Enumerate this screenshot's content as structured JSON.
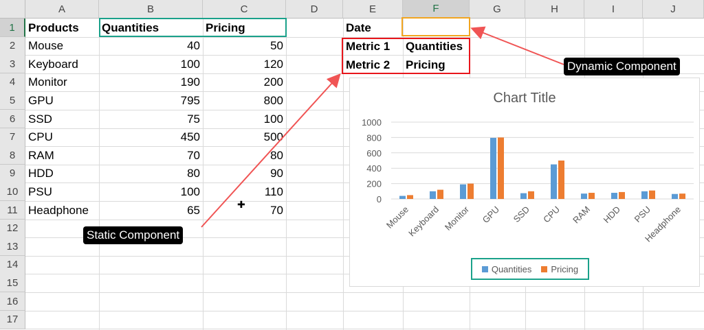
{
  "sheet": {
    "columns": [
      "A",
      "B",
      "C",
      "D",
      "E",
      "F",
      "G",
      "H",
      "I",
      "J"
    ],
    "rows": [
      "1",
      "2",
      "3",
      "4",
      "5",
      "6",
      "7",
      "8",
      "9",
      "10",
      "11",
      "12",
      "13",
      "14",
      "15",
      "16",
      "17"
    ],
    "selected_column": "F",
    "selected_row": "1"
  },
  "table": {
    "headers": [
      "Products",
      "Quantities",
      "Pricing"
    ],
    "rows": [
      [
        "Mouse",
        "40",
        "50"
      ],
      [
        "Keyboard",
        "100",
        "120"
      ],
      [
        "Monitor",
        "190",
        "200"
      ],
      [
        "GPU",
        "795",
        "800"
      ],
      [
        "SSD",
        "75",
        "100"
      ],
      [
        "CPU",
        "450",
        "500"
      ],
      [
        "RAM",
        "70",
        "80"
      ],
      [
        "HDD",
        "80",
        "90"
      ],
      [
        "PSU",
        "100",
        "110"
      ],
      [
        "Headphone",
        "65",
        "70"
      ]
    ]
  },
  "controls": {
    "date_label": "Date",
    "date_value": "",
    "metric1_label": "Metric 1",
    "metric1_value": "Quantities",
    "metric2_label": "Metric 2",
    "metric2_value": "Pricing"
  },
  "callouts": {
    "static": "Static Component",
    "dynamic": "Dynamic Component"
  },
  "colors": {
    "green_highlight": "#1aa18a",
    "red_highlight": "#e8151b",
    "orange_highlight": "#f2a51f",
    "arrow": "#f05454",
    "series_quantities": "#5b9bd5",
    "series_pricing": "#ed7d31",
    "excel_green": "#217346"
  },
  "chart_data": {
    "type": "bar",
    "title": "Chart Title",
    "categories": [
      "Mouse",
      "Keyboard",
      "Monitor",
      "GPU",
      "SSD",
      "CPU",
      "RAM",
      "HDD",
      "PSU",
      "Headphone"
    ],
    "series": [
      {
        "name": "Quantities",
        "values": [
          40,
          100,
          190,
          795,
          75,
          450,
          70,
          80,
          100,
          65
        ]
      },
      {
        "name": "Pricing",
        "values": [
          50,
          120,
          200,
          800,
          100,
          500,
          80,
          90,
          110,
          70
        ]
      }
    ],
    "ylim": [
      0,
      1000
    ],
    "yticks": [
      "0",
      "200",
      "400",
      "600",
      "800",
      "1000"
    ],
    "grid": true,
    "legend": "bottom"
  }
}
